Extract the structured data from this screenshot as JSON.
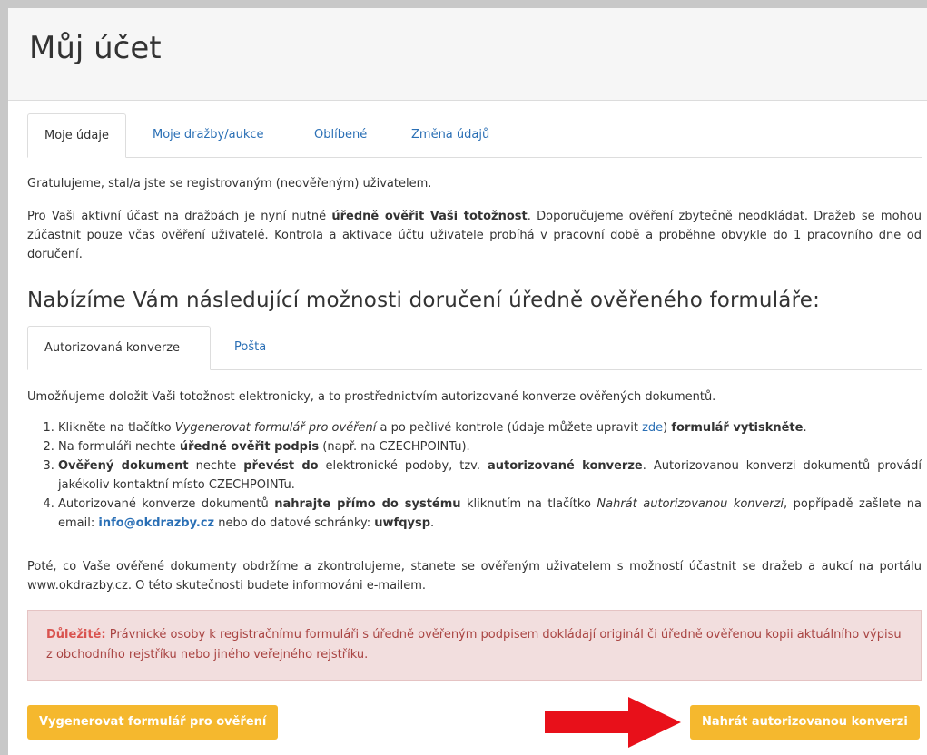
{
  "page": {
    "title": "Můj účet"
  },
  "tabs": [
    {
      "label": "Moje údaje",
      "active": true
    },
    {
      "label": "Moje dražby/aukce",
      "active": false
    },
    {
      "label": "Oblíbené",
      "active": false
    },
    {
      "label": "Změna údajů",
      "active": false
    }
  ],
  "intro": {
    "congrats": "Gratulujeme, stal/a jste se registrovaným (neověřeným) uživatelem.",
    "verify_pre": "Pro Vaši aktivní účast na dražbách je nyní nutné ",
    "verify_bold": "úředně ověřit Vaši totožnost",
    "verify_post": ". Doporučujeme ověření zbytečně neodkládat. Dražeb se mohou zúčastnit pouze včas ověření uživatelé. Kontrola a aktivace účtu uživatele probíhá v pracovní době a proběhne obvykle do 1 pracovního dne od doručení."
  },
  "section": {
    "title": "Nabízíme Vám následující možnosti doručení úředně ověřeného formuláře:"
  },
  "delivery_tabs": [
    {
      "label": "Autorizovaná konverze",
      "active": true
    },
    {
      "label": "Pošta",
      "active": false
    }
  ],
  "conversion": {
    "intro": "Umožňujeme doložit Vaši totožnost elektronicky, a to prostřednictvím autorizované konverze ověřených dokumentů.",
    "step1": {
      "pre": "Klikněte na tlačítko ",
      "italic": "Vygenerovat formulář pro ověření",
      "mid": " a po pečlivé kontrole (údaje můžete upravit ",
      "link": "zde",
      "mid2": ") ",
      "bold": "formulář vytiskněte",
      "post": "."
    },
    "step2": {
      "pre": "Na formuláři nechte ",
      "bold": "úředně ověřit podpis",
      "post": " (např. na CZECHPOINTu)."
    },
    "step3": {
      "bold1": "Ověřený dokument",
      "t1": " nechte ",
      "bold2": "převést do",
      "t2": " elektronické podoby, tzv. ",
      "bold3": "autorizované konverze",
      "t3": ". Autorizovanou konverzi dokumentů provádí jakékoliv kontaktní místo CZECHPOINTu."
    },
    "step4": {
      "t1": "Autorizované konverze dokumentů ",
      "bold1": "nahrajte přímo do systému",
      "t2": " kliknutím na tlačítko ",
      "italic": "Nahrát autorizovanou konverzi",
      "t3": ", popřípadě zašlete na email: ",
      "email": "info@okdrazby.cz",
      "t4": " nebo do datové schránky: ",
      "bold2": "uwfqysp",
      "t5": "."
    },
    "after": "Poté, co Vaše ověřené dokumenty obdržíme a zkontrolujeme, stanete se ověřeným uživatelem s možností účastnit se dražeb a aukcí na portálu www.okdrazby.cz. O této skutečnosti budete informováni e-mailem."
  },
  "alert": {
    "label": "Důležité:",
    "text": " Právnické osoby k registračnímu formuláři s úředně ověřeným podpisem dokládají originál či úředně ověřenou kopii aktuálního výpisu z obchodního rejstříku nebo jiného veřejného rejstříku."
  },
  "buttons": {
    "generate": "Vygenerovat formulář pro ověření",
    "upload": "Nahrát autorizovanou konverzi"
  },
  "colors": {
    "button": "#f5b82e",
    "link": "#2a6fb5",
    "alert_bg": "#f2dede",
    "alert_label": "#d9534f",
    "arrow": "#e8101a"
  },
  "icons": {
    "arrow": "red-arrow-right-icon"
  }
}
